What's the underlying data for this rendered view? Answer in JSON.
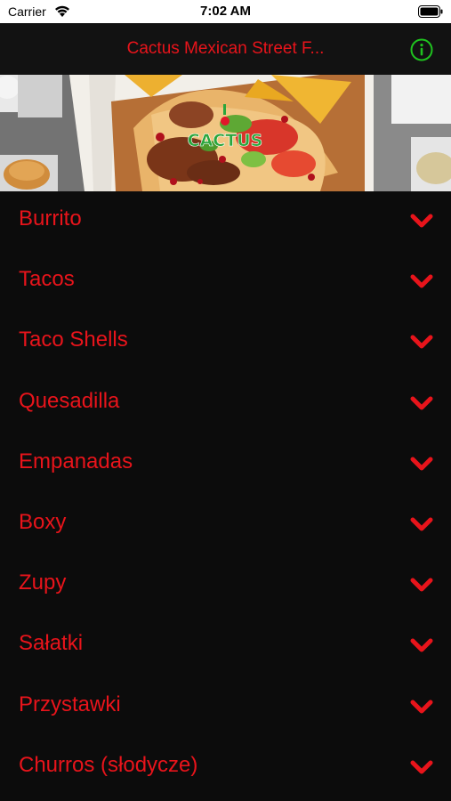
{
  "status_bar": {
    "carrier": "Carrier",
    "time": "7:02 AM",
    "wifi_icon": "wifi-icon",
    "battery_icon": "battery-icon"
  },
  "nav": {
    "title": "Cactus Mexican Street F...",
    "info_icon": "info-icon",
    "title_color": "#e8141b",
    "info_color": "#1fc21f"
  },
  "hero": {
    "logo_text": "CACTUS"
  },
  "menu": {
    "chevron_icon": "chevron-down-icon",
    "items": [
      {
        "label": "Burrito"
      },
      {
        "label": "Tacos"
      },
      {
        "label": "Taco Shells"
      },
      {
        "label": "Quesadilla"
      },
      {
        "label": "Empanadas"
      },
      {
        "label": "Boxy"
      },
      {
        "label": "Zupy"
      },
      {
        "label": "Sałatki"
      },
      {
        "label": "Przystawki"
      },
      {
        "label": "Churros (słodycze)"
      }
    ]
  },
  "colors": {
    "accent": "#e8141b",
    "background": "#0c0c0c"
  }
}
